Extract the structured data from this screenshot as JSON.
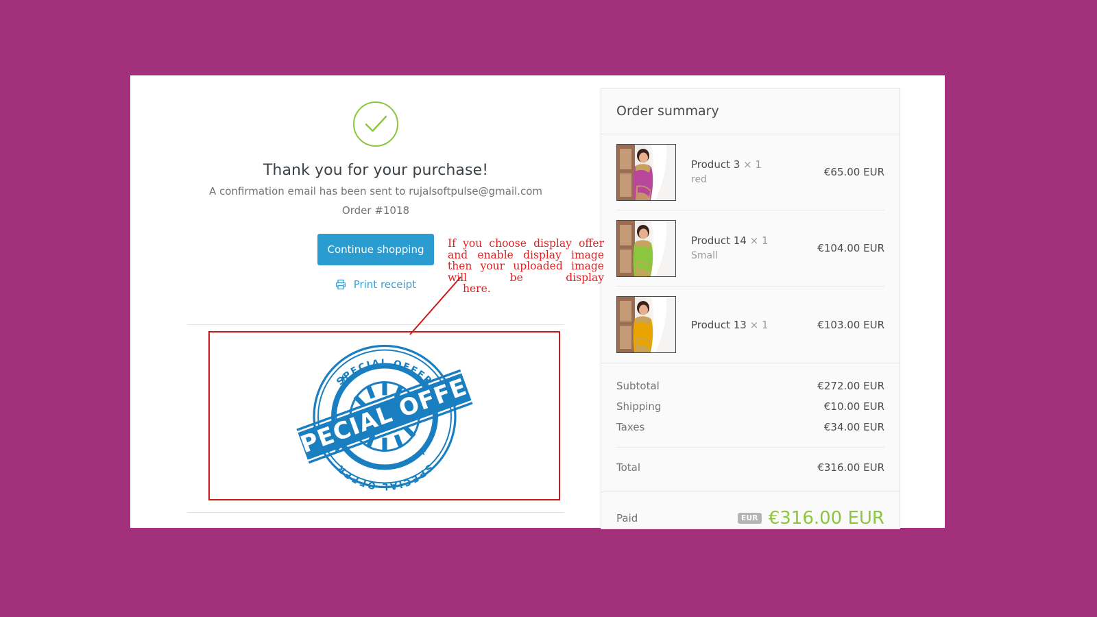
{
  "theme": {
    "page_background": "#a3307a",
    "card_background": "#ffffff",
    "accent_blue": "#2b9cd0",
    "success_green": "#8cc63e",
    "annotation_red": "#e02020",
    "box_border_red": "#cc1717",
    "stamp_blue": "#1a7fc1",
    "badge_gray": "#b5b5b5"
  },
  "confirmation": {
    "check_icon": "check-circle-icon",
    "title": "Thank you for your purchase!",
    "email_line": "A confirmation email has been sent to rujalsoftpulse@gmail.com",
    "order_number": "Order #1018",
    "continue_button": "Continue shopping",
    "print_icon": "printer-icon",
    "print_label": "Print receipt"
  },
  "annotation": {
    "line1": "If you choose display offer and",
    "line2": "enable display image then your",
    "line3": "uploaded image will be display",
    "line4": "here.",
    "arrow_icon": "arrow-pointer-line"
  },
  "offer_image": {
    "alt": "special-offer-stamp",
    "outer_ring_text": "SPECIAL OFFER",
    "lower_ring_text": "SPECIAL OFFER",
    "banner_text": "SPECIAL OFFER",
    "star_glyph": "★"
  },
  "order_summary": {
    "title": "Order summary",
    "items": [
      {
        "name": "Product 3",
        "qty_separator": "×",
        "qty": "1",
        "variant": "red",
        "price": "€65.00 EUR",
        "thumb": "saree-pink-thumbnail"
      },
      {
        "name": "Product 14",
        "qty_separator": "×",
        "qty": "1",
        "variant": "Small",
        "price": "€104.00 EUR",
        "thumb": "saree-green-thumbnail"
      },
      {
        "name": "Product 13",
        "qty_separator": "×",
        "qty": "1",
        "variant": "",
        "price": "€103.00 EUR",
        "thumb": "saree-orange-thumbnail"
      }
    ],
    "totals": [
      {
        "label": "Subtotal",
        "value": "€272.00 EUR"
      },
      {
        "label": "Shipping",
        "value": "€10.00 EUR"
      },
      {
        "label": "Taxes",
        "value": "€34.00 EUR"
      }
    ],
    "grand_total": {
      "label": "Total",
      "value": "€316.00 EUR"
    },
    "paid": {
      "label": "Paid",
      "currency_badge": "EUR",
      "amount": "€316.00 EUR"
    }
  }
}
